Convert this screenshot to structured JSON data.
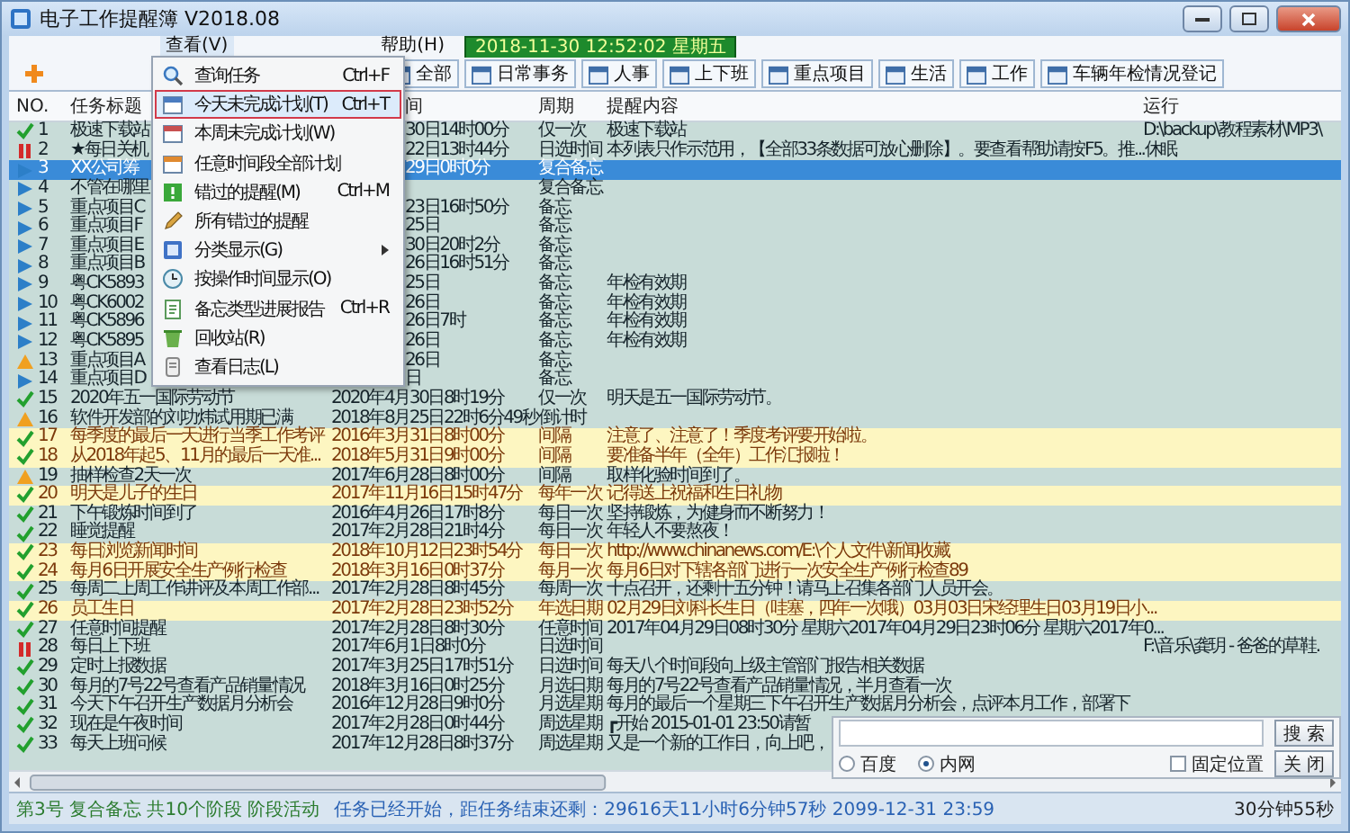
{
  "window": {
    "title": "电子工作提醒簿 V2018.08"
  },
  "menu_bar": [
    {
      "label": "查看(V)",
      "selected": true
    },
    {
      "label": "帮助(H)",
      "selected": false
    }
  ],
  "clock": "2018-11-30 12:52:02 星期五",
  "categories": [
    "全部",
    "日常事务",
    "人事",
    "上下班",
    "重点项目",
    "生活",
    "工作",
    "车辆年检情况登记"
  ],
  "view_menu": [
    {
      "label": "查询任务",
      "shortcut": "Ctrl+F",
      "submenu": false,
      "selected": false
    },
    {
      "label": "今天未完成计划(T)",
      "shortcut": "Ctrl+T",
      "submenu": false,
      "selected": true
    },
    {
      "label": "本周未完成计划(W)",
      "submenu": false,
      "selected": false
    },
    {
      "label": "任意时间段全部计划",
      "submenu": false,
      "selected": false
    },
    {
      "label": "错过的提醒(M)",
      "shortcut": "Ctrl+M",
      "submenu": false,
      "selected": false
    },
    {
      "label": "所有错过的提醒",
      "submenu": false,
      "selected": false
    },
    {
      "label": "分类显示(G)",
      "submenu": true,
      "selected": false
    },
    {
      "label": "按操作时间显示(O)",
      "submenu": false,
      "selected": false
    },
    {
      "label": "备忘类型进展报告",
      "shortcut": "Ctrl+R",
      "submenu": false,
      "selected": false
    },
    {
      "label": "回收站(R)",
      "submenu": false,
      "selected": false
    },
    {
      "label": "查看日志(L)",
      "submenu": false,
      "selected": false
    }
  ],
  "table": {
    "columns": [
      "NO.",
      "任务标题",
      "间",
      "周期",
      "提醒内容",
      "运行"
    ],
    "rows": [
      {
        "kind": "done",
        "no": "1",
        "title": "极速下载站",
        "time": "30日14时00分",
        "cycle": "仅一次",
        "content": "极速下载站",
        "run": "D:\\backup\\教程素材\\MP3\\",
        "highlight": false,
        "selected": false
      },
      {
        "kind": "paused",
        "no": "2",
        "title": "★每日关机",
        "time": "22日13时44分",
        "cycle": "日选时间",
        "content": "本列表只作示范用，【全部33条数据可放心删除】。要查看帮助请按F5。推...",
        "run": "休眠",
        "highlight": false,
        "selected": false
      },
      {
        "kind": "active",
        "no": "3",
        "title": "XX公司筹",
        "time": "29日0时0分",
        "cycle": "复合备忘",
        "highlight": false,
        "selected": true
      },
      {
        "kind": "active",
        "no": "4",
        "title": "不管在哪里",
        "cycle": "复合备忘",
        "highlight": false,
        "selected": false
      },
      {
        "kind": "active",
        "no": "5",
        "title": "重点项目C",
        "time": "23日16时50分",
        "cycle": "备忘",
        "highlight": false,
        "selected": false
      },
      {
        "kind": "active",
        "no": "6",
        "title": "重点项目F",
        "time": "25日",
        "cycle": "备忘",
        "highlight": false,
        "selected": false
      },
      {
        "kind": "active",
        "no": "7",
        "title": "重点项目E",
        "time": "30日20时2分",
        "cycle": "备忘",
        "highlight": false,
        "selected": false
      },
      {
        "kind": "active",
        "no": "8",
        "title": "重点项目B",
        "time": "26日16时51分",
        "cycle": "备忘",
        "highlight": false,
        "selected": false
      },
      {
        "kind": "active",
        "no": "9",
        "title": "粤CK5893",
        "time": "25日",
        "cycle": "备忘",
        "content": "年检有效期",
        "highlight": false,
        "selected": false
      },
      {
        "kind": "active",
        "no": "10",
        "title": "粤CK6002",
        "time": "26日",
        "cycle": "备忘",
        "content": "年检有效期",
        "highlight": false,
        "selected": false
      },
      {
        "kind": "active",
        "no": "11",
        "title": "粤CK5896",
        "time": "26日7时",
        "cycle": "备忘",
        "content": "年检有效期",
        "highlight": false,
        "selected": false
      },
      {
        "kind": "active",
        "no": "12",
        "title": "粤CK5895",
        "time": "26日",
        "cycle": "备忘",
        "content": "年检有效期",
        "highlight": false,
        "selected": false
      },
      {
        "kind": "warning",
        "no": "13",
        "title": "重点项目A",
        "time": "26日",
        "cycle": "备忘",
        "highlight": false,
        "selected": false
      },
      {
        "kind": "active",
        "no": "14",
        "title": "重点项目D",
        "time": "日",
        "cycle": "备忘",
        "highlight": false,
        "selected": false
      },
      {
        "kind": "done",
        "no": "15",
        "title": "2020年五一国际劳动节",
        "time": "2020年4月30日8时19分",
        "cycle": "仅一次",
        "content": "明天是五一国际劳动节。",
        "highlight": false,
        "selected": false
      },
      {
        "kind": "warning",
        "no": "16",
        "title": "软件开发部的刘功炜试用期已满",
        "time": "2018年8月25日22时6分49秒",
        "cycle": "倒计时",
        "highlight": false,
        "selected": false
      },
      {
        "kind": "done",
        "no": "17",
        "title": "每季度的最后一天进行当季工作考评",
        "time": "2016年3月31日8时00分",
        "cycle": "间隔",
        "content": "注意了、注意了！季度考评要开始啦。",
        "highlight": true,
        "selected": false
      },
      {
        "kind": "done",
        "no": "18",
        "title": "从2018年起5、11月的最后一天准...",
        "time": "2018年5月31日9时00分",
        "cycle": "间隔",
        "content": "要准备半年（全年）工作汇报啦！",
        "highlight": true,
        "selected": false
      },
      {
        "kind": "warning",
        "no": "19",
        "title": "抽样检查2天一次",
        "time": "2017年6月28日8时00分",
        "cycle": "间隔",
        "content": "取样化验时间到了。",
        "highlight": false,
        "selected": false
      },
      {
        "kind": "done",
        "no": "20",
        "title": "明天是儿子的生日",
        "time": "2017年11月16日15时47分",
        "cycle": "每年一次",
        "content": "记得送上祝福和生日礼物",
        "highlight": true,
        "selected": false
      },
      {
        "kind": "done",
        "no": "21",
        "title": "下午锻炼时间到了",
        "time": "2016年4月26日17时8分",
        "cycle": "每日一次",
        "content": "坚持锻炼，为健身而不断努力！",
        "highlight": false,
        "selected": false
      },
      {
        "kind": "done",
        "no": "22",
        "title": "睡觉提醒",
        "time": "2017年2月28日21时4分",
        "cycle": "每日一次",
        "content": "年轻人不要熬夜！",
        "highlight": false,
        "selected": false
      },
      {
        "kind": "done",
        "no": "23",
        "title": "每日浏览新闻时间",
        "time": "2018年10月12日23时54分",
        "cycle": "每日一次",
        "content": "http://www.chinanews.com/E:\\个人文件\\新闻收藏",
        "highlight": true,
        "selected": false
      },
      {
        "kind": "done",
        "no": "24",
        "title": "每月6日开展安全生产例行检查",
        "time": "2018年3月16日0时37分",
        "cycle": "每月一次",
        "content": "每月6日对下辖各部门进行一次安全生产例行检查89",
        "highlight": true,
        "selected": false
      },
      {
        "kind": "done",
        "no": "25",
        "title": "每周二上周工作讲评及本周工作部...",
        "time": "2017年2月28日8时45分",
        "cycle": "每周一次",
        "content": "十点召开，还剩十五分钟！请马上召集各部门人员开会。",
        "highlight": false,
        "selected": false
      },
      {
        "kind": "done",
        "no": "26",
        "title": "员工生日",
        "time": "2017年2月28日23时52分",
        "cycle": "年选日期",
        "content": "02月29日刘科长生日（哇塞，四年一次哦）03月03日宋经理生日03月19日小...",
        "highlight": true,
        "selected": false
      },
      {
        "kind": "done",
        "no": "27",
        "title": "任意时间提醒",
        "time": "2017年2月28日8时30分",
        "cycle": "任意时间",
        "content": "2017年04月29日08时30分 星期六2017年04月29日23时06分 星期六2017年0...",
        "highlight": false,
        "selected": false
      },
      {
        "kind": "paused",
        "no": "28",
        "title": "每日上下班",
        "time": "2017年6月1日8时0分",
        "cycle": "日选时间",
        "run": "F:\\音乐\\龚玥 - 爸爸的草鞋.",
        "highlight": false,
        "selected": false
      },
      {
        "kind": "done",
        "no": "29",
        "title": "定时上报数据",
        "time": "2017年3月25日17时51分",
        "cycle": "日选时间",
        "content": "每天八个时间段向上级主管部门报告相关数据",
        "highlight": false,
        "selected": false
      },
      {
        "kind": "done",
        "no": "30",
        "title": "每月的7号22号查看产品销量情况",
        "time": "2018年3月16日0时25分",
        "cycle": "月选日期",
        "content": "每月的7号22号查看产品销量情况，半月查看一次",
        "highlight": false,
        "selected": false
      },
      {
        "kind": "done",
        "no": "31",
        "title": "今天下午召开生产数据月分析会",
        "time": "2016年12月28日9时0分",
        "cycle": "月选星期",
        "content": "每月的最后一个星期三下午召开生产数据月分析会，点评本月工作，部署下",
        "highlight": false,
        "selected": false
      },
      {
        "kind": "done",
        "no": "32",
        "title": "现在是午夜时间",
        "time": "2017年2月28日0时44分",
        "cycle": "周选星期",
        "content": "┏开始 2015-01-01 23:50请暂",
        "highlight": false,
        "selected": false
      },
      {
        "kind": "done",
        "no": "33",
        "title": "每天上班问候",
        "time": "2017年12月28日8时37分",
        "cycle": "周选星期",
        "content": "又是一个新的工作日，向上吧，",
        "highlight": false,
        "selected": false
      }
    ]
  },
  "search_panel": {
    "search_button": "搜 索",
    "engines": [
      {
        "label": "百度",
        "selected": false
      },
      {
        "label": "内网",
        "selected": true
      }
    ],
    "pin": {
      "label": "固定位置",
      "checked": false
    },
    "close_button": "关 闭"
  },
  "status_bar": {
    "stage": "第3号 复合备忘 共10个阶段 阶段活动",
    "countdown": "任务已经开始，距任务结束还剩：29616天11小时6分钟57秒 2099-12-31 23:59",
    "timer": "30分钟55秒"
  }
}
